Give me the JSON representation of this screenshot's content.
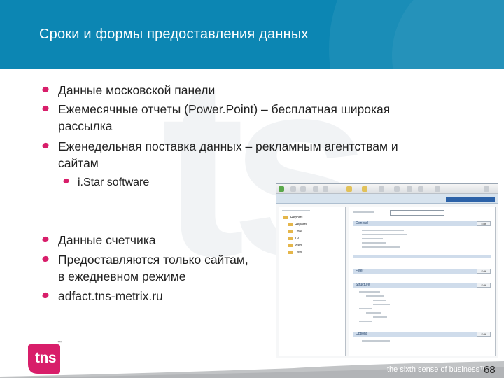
{
  "slide": {
    "title": "Сроки и формы предоставления данных",
    "bullets": [
      {
        "text": "Данные московской панели",
        "level": 1
      },
      {
        "text": "Ежемесячные отчеты (Power.Point) – бесплатная широкая",
        "level": 1
      },
      {
        "text": "рассылка",
        "level": 1,
        "continuation": true
      },
      {
        "text": "Еженедельная поставка данных – рекламным агентствам и",
        "level": 1
      },
      {
        "text": "сайтам",
        "level": 1,
        "continuation": true
      },
      {
        "text": "i.Star software",
        "level": 2
      },
      {
        "text": "Данные счетчика",
        "level": 1
      },
      {
        "text": "Предоставляются только сайтам,",
        "level": 1
      },
      {
        "text": "в ежедневном режиме",
        "level": 1,
        "continuation": true
      },
      {
        "text": "adfact.tns-metrix.ru",
        "level": 1
      }
    ],
    "embedded_screenshot": {
      "description": "i.Star software window (small, illegible detail)",
      "tree_items": [
        "Reports",
        "Reports",
        "Core",
        "TV",
        "Web",
        "Lists"
      ],
      "section_headers": [
        "General",
        "Filter",
        "Structure",
        "Options"
      ],
      "section_button": "Edit"
    },
    "logo_text": "tns",
    "logo_tm": "™",
    "footer_tagline": "the sixth sense of business™",
    "page_number": "68"
  },
  "colors": {
    "header_bg": "#0c86b3",
    "bullet_accent": "#d81e6a",
    "logo_magenta": "#d81e6a",
    "footer_band": "#b2b4b7"
  }
}
